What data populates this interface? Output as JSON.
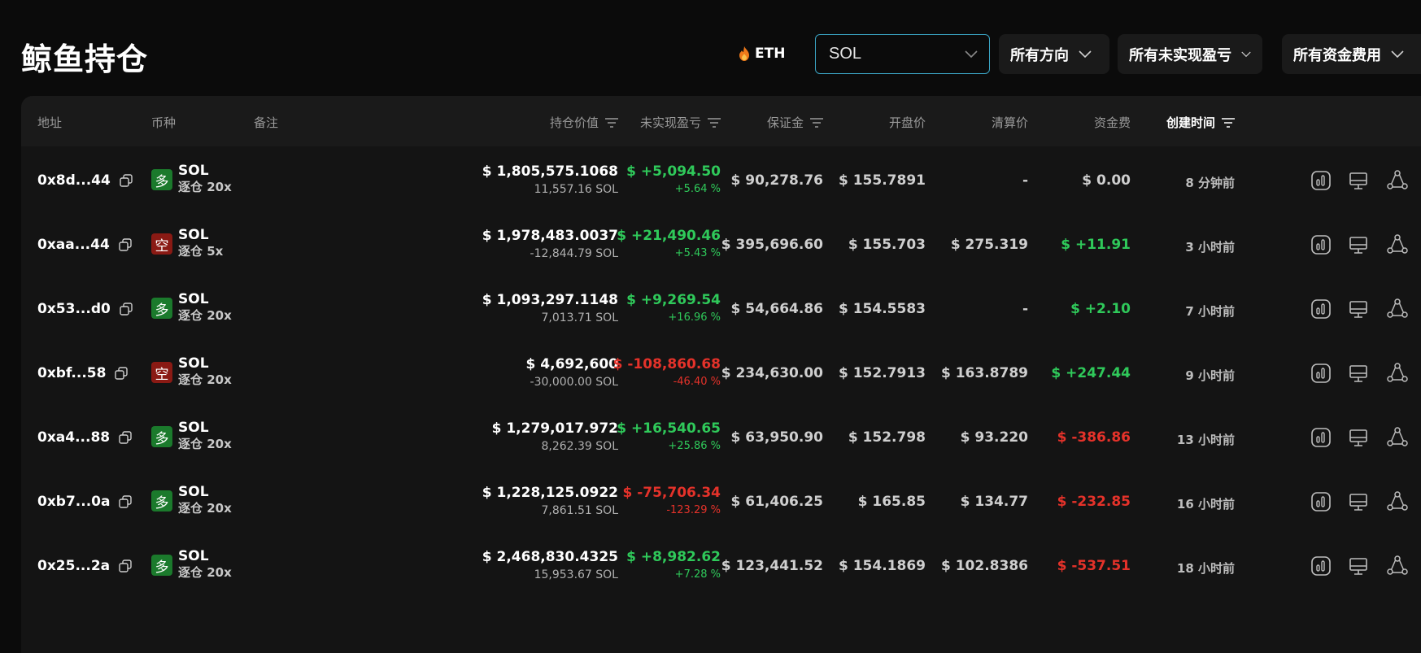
{
  "page": {
    "title": "鲸鱼持仓"
  },
  "topbar": {
    "eth_label": "ETH",
    "search_value": "SOL",
    "filters": [
      "所有方向",
      "所有未实现盈亏",
      "所有资金费用"
    ]
  },
  "table": {
    "headers": {
      "address": "地址",
      "coin": "币种",
      "note": "备注",
      "value": "持仓价值",
      "pnl": "未实现盈亏",
      "margin": "保证金",
      "entry": "开盘价",
      "liq": "清算价",
      "funding": "资金费",
      "created": "创建时间"
    },
    "rows": [
      {
        "address": "0x8d...44",
        "dir": "多",
        "side": "long",
        "symbol": "SOL",
        "leverage": "逐仓 20x",
        "value_usd": "$ 1,805,575.1068",
        "qty": "11,557.16 SOL",
        "pnl": "$ +5,094.50",
        "pnl_pct": "+5.64 %",
        "pnl_sign": "pos",
        "margin": "$ 90,278.76",
        "entry": "$ 155.7891",
        "liq": "-",
        "funding": "$ 0.00",
        "funding_sign": "zero",
        "created": "8 分钟前"
      },
      {
        "address": "0xaa...44",
        "dir": "空",
        "side": "short",
        "symbol": "SOL",
        "leverage": "逐仓 5x",
        "value_usd": "$ 1,978,483.0037",
        "qty": "-12,844.79 SOL",
        "pnl": "$ +21,490.46",
        "pnl_pct": "+5.43 %",
        "pnl_sign": "pos",
        "margin": "$ 395,696.60",
        "entry": "$ 155.703",
        "liq": "$ 275.319",
        "funding": "$ +11.91",
        "funding_sign": "pos",
        "created": "3 小时前"
      },
      {
        "address": "0x53...d0",
        "dir": "多",
        "side": "long",
        "symbol": "SOL",
        "leverage": "逐仓 20x",
        "value_usd": "$ 1,093,297.1148",
        "qty": "7,013.71 SOL",
        "pnl": "$ +9,269.54",
        "pnl_pct": "+16.96 %",
        "pnl_sign": "pos",
        "margin": "$ 54,664.86",
        "entry": "$ 154.5583",
        "liq": "-",
        "funding": "$ +2.10",
        "funding_sign": "pos",
        "created": "7 小时前"
      },
      {
        "address": "0xbf...58",
        "dir": "空",
        "side": "short",
        "symbol": "SOL",
        "leverage": "逐仓 20x",
        "value_usd": "$ 4,692,600",
        "qty": "-30,000.00 SOL",
        "pnl": "$ -108,860.68",
        "pnl_pct": "-46.40 %",
        "pnl_sign": "neg",
        "margin": "$ 234,630.00",
        "entry": "$ 152.7913",
        "liq": "$ 163.8789",
        "funding": "$ +247.44",
        "funding_sign": "pos",
        "created": "9 小时前"
      },
      {
        "address": "0xa4...88",
        "dir": "多",
        "side": "long",
        "symbol": "SOL",
        "leverage": "逐仓 20x",
        "value_usd": "$ 1,279,017.972",
        "qty": "8,262.39 SOL",
        "pnl": "$ +16,540.65",
        "pnl_pct": "+25.86 %",
        "pnl_sign": "pos",
        "margin": "$ 63,950.90",
        "entry": "$ 152.798",
        "liq": "$ 93.220",
        "funding": "$ -386.86",
        "funding_sign": "neg",
        "created": "13 小时前"
      },
      {
        "address": "0xb7...0a",
        "dir": "多",
        "side": "long",
        "symbol": "SOL",
        "leverage": "逐仓 20x",
        "value_usd": "$ 1,228,125.0922",
        "qty": "7,861.51 SOL",
        "pnl": "$ -75,706.34",
        "pnl_pct": "-123.29 %",
        "pnl_sign": "neg",
        "margin": "$ 61,406.25",
        "entry": "$ 165.85",
        "liq": "$ 134.77",
        "funding": "$ -232.85",
        "funding_sign": "neg",
        "created": "16 小时前"
      },
      {
        "address": "0x25...2a",
        "dir": "多",
        "side": "long",
        "symbol": "SOL",
        "leverage": "逐仓 20x",
        "value_usd": "$ 2,468,830.4325",
        "qty": "15,953.67 SOL",
        "pnl": "$ +8,982.62",
        "pnl_pct": "+7.28 %",
        "pnl_sign": "pos",
        "margin": "$ 123,441.52",
        "entry": "$ 154.1869",
        "liq": "$ 102.8386",
        "funding": "$ -537.51",
        "funding_sign": "neg",
        "created": "18 小时前"
      }
    ]
  },
  "icons": {
    "eth": "flame-icon",
    "copy": "copy-icon",
    "filter": "filter-icon",
    "chevron": "chevron-down-icon",
    "actions": [
      "chart-icon",
      "monitor-icon",
      "share-icon"
    ]
  },
  "colors": {
    "positive": "#2fc95a",
    "negative": "#e5322a",
    "long_badge": "#1b7a2c",
    "short_badge": "#8a1a14",
    "accent_border": "#3aa3c2"
  }
}
